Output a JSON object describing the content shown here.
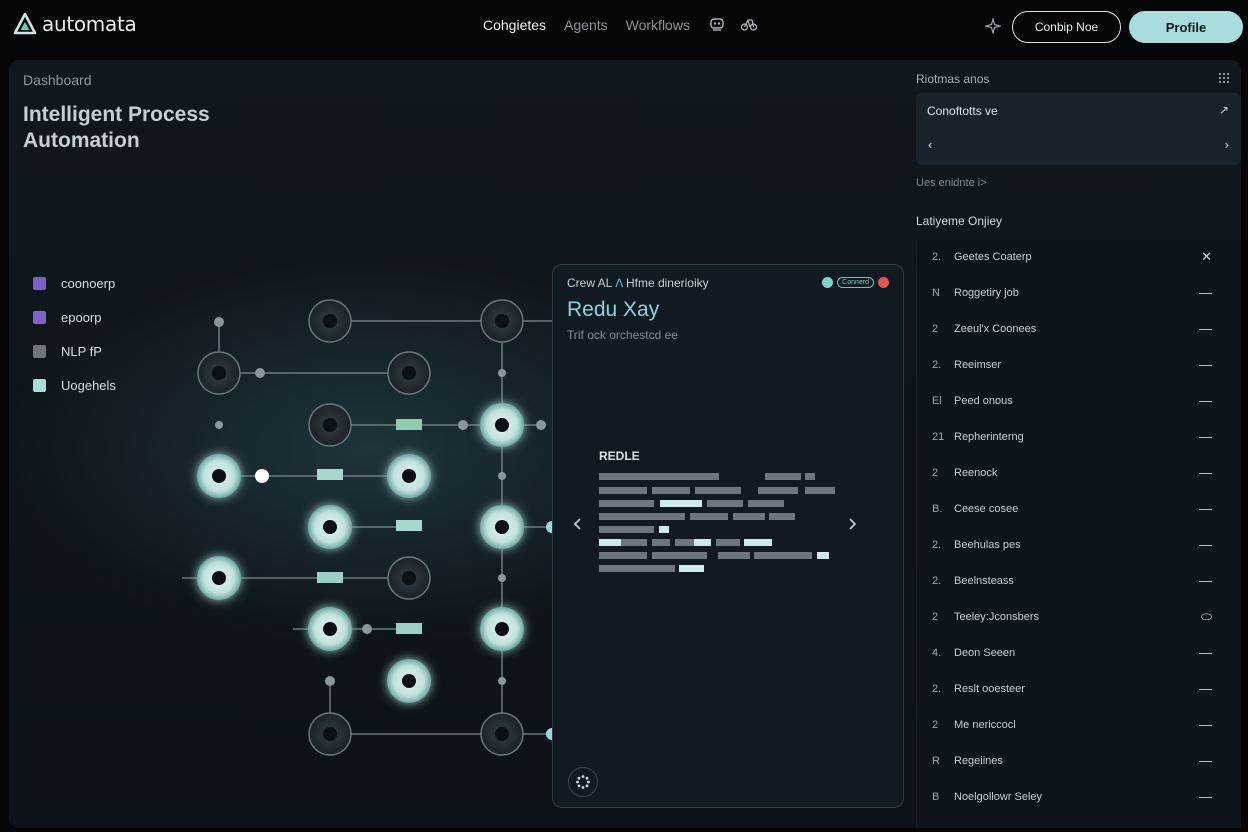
{
  "app": {
    "name": "automata"
  },
  "nav": {
    "items": [
      {
        "label": "Cohgietes",
        "active": true
      },
      {
        "label": "Agents",
        "active": false
      },
      {
        "label": "Workflows",
        "active": false
      }
    ],
    "icons": [
      "robot-icon",
      "bike-icon",
      "sparkle-icon"
    ],
    "outline_button": "Conbip Noe",
    "profile_button": "Profile"
  },
  "main": {
    "breadcrumb": "Dashboard",
    "headline": "Intelligent Process Automation",
    "legend": [
      {
        "label": "coonoerp",
        "color": "#7a5fc7"
      },
      {
        "label": "epoorp",
        "color": "#7e63cc"
      },
      {
        "label": "NLP fP",
        "color": "#6f767b"
      },
      {
        "label": "Uogehels",
        "color": "#a9dcd6"
      }
    ]
  },
  "card": {
    "header_prefix": "Crew AL",
    "header_accent": "Λ",
    "header_rest": "Hfme dinerioiky",
    "badge_label": "Connerd",
    "badge_colors": [
      "#7ed3c6",
      "#e05656"
    ],
    "title": "Redu Xay",
    "subtitle": "Trif ock orchestcd ee",
    "section_label": "REDLE",
    "prev_icon": "chevron-left-icon",
    "next_icon": "chevron-right-icon",
    "fab_icon": "dots-ring-icon"
  },
  "right": {
    "title": "Riotmas anos",
    "card_title": "Conoftotts ve",
    "card_arrow": "↗",
    "card_prev": "‹",
    "card_next": "›",
    "subtitle": "Ues enidnte i>",
    "list_title": "Latiyeme Onjiey",
    "rows": [
      {
        "num": "2.",
        "label": "Geetes Coaterp",
        "action": "✕"
      },
      {
        "num": "N",
        "label": "Roggetiry job",
        "action": "—"
      },
      {
        "num": "2",
        "label": "Zeeul'x Coonees",
        "action": "—"
      },
      {
        "num": "2.",
        "label": "Reeimser",
        "action": "—"
      },
      {
        "num": "El",
        "label": "Peed onous",
        "action": "—"
      },
      {
        "num": "21",
        "label": "Repherinterng",
        "action": "—"
      },
      {
        "num": "2",
        "label": "Reenock",
        "action": "—"
      },
      {
        "num": "B.",
        "label": "Ceese cosee",
        "action": "—"
      },
      {
        "num": "2.",
        "label": "Beehulas pes",
        "action": "—"
      },
      {
        "num": "2.",
        "label": "Beelnsteass",
        "action": "—"
      },
      {
        "num": "2",
        "label": "Teeley:Jconsbers",
        "action": "⬭"
      },
      {
        "num": "4.",
        "label": "Deon Seeen",
        "action": "—"
      },
      {
        "num": "2.",
        "label": "Reslt ooesteer",
        "action": "—"
      },
      {
        "num": "2",
        "label": "Me nericcocl",
        "action": "—"
      },
      {
        "num": "R",
        "label": "Regeiines",
        "action": "—"
      },
      {
        "num": "B",
        "label": "Noelgollowr Seley",
        "action": "—"
      }
    ]
  }
}
